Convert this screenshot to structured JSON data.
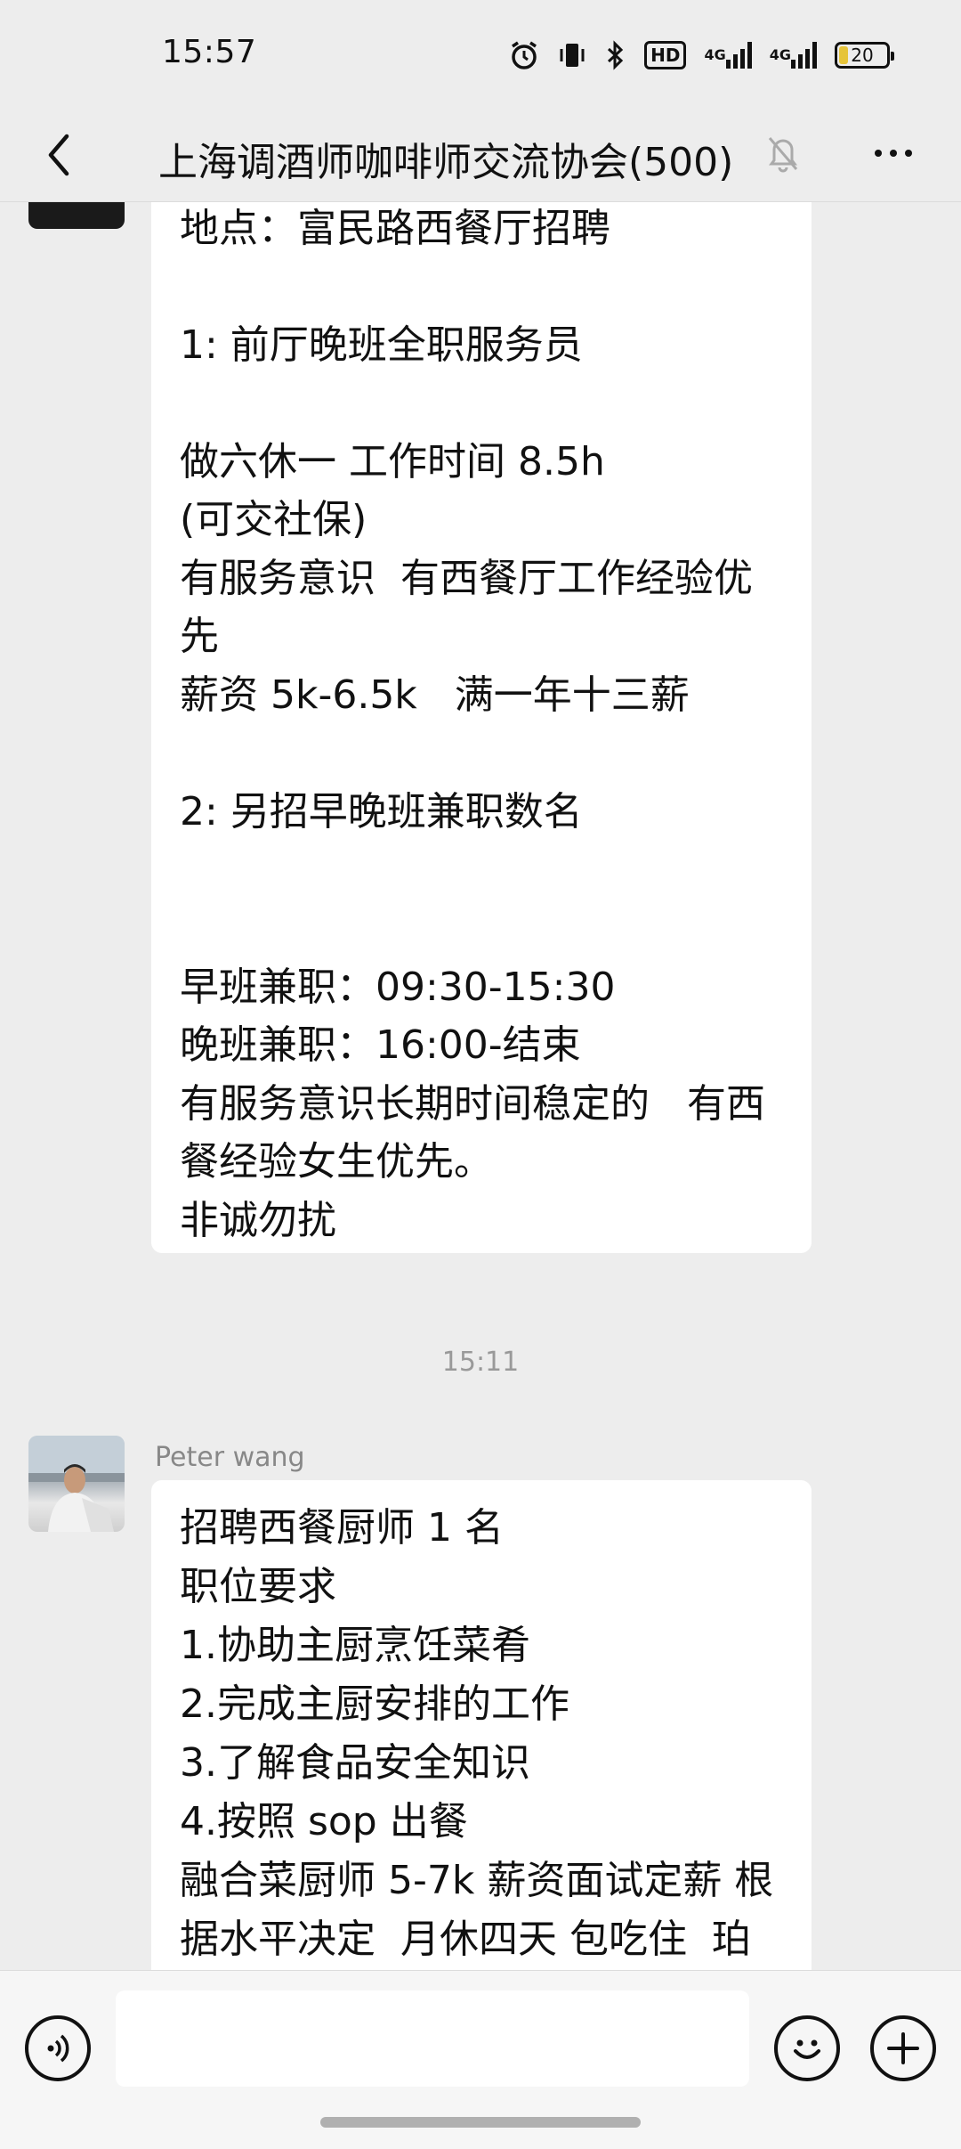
{
  "status_bar": {
    "time": "15:57",
    "hd_label": "HD",
    "network_1": "4G",
    "network_2": "4G",
    "battery_level": "20",
    "battery_fill_fraction": 0.2,
    "battery_color": "#e6c43a"
  },
  "header": {
    "title": "上海调酒师咖啡师交流协会(500)"
  },
  "messages": [
    {
      "lines": [
        "地点：富民路西餐厅招聘",
        "",
        "1: 前厅晚班全职服务员",
        "",
        "做六休一 工作时间 8.5h",
        "(可交社保)",
        "有服务意识  有西餐厅工作经验优",
        "先",
        "薪资 5k-6.5k   满一年十三薪",
        "",
        "2: 另招早晚班兼职数名",
        "",
        "",
        "早班兼职：09:30-15:30",
        "晚班兼职：16:00-结束",
        "有服务意识长期时间稳定的   有西",
        "餐经验女生优先。",
        "非诚勿扰"
      ]
    },
    {
      "time_separator": "15:11",
      "sender": "Peter wang",
      "lines": [
        "招聘西餐厨师 1 名",
        "职位要求",
        "1.协助主厨烹饪菜肴",
        "2.完成主厨安排的工作",
        "3.了解食品安全知识",
        "4.按照 sop 出餐",
        "融合菜厨师 5-7k 薪资面试定薪 根",
        "据水平决定  月休四天 包吃住  珀"
      ]
    }
  ],
  "input_bar": {
    "placeholder": ""
  }
}
